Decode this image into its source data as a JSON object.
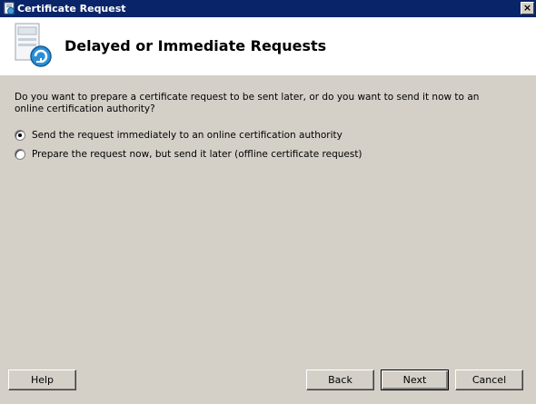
{
  "window": {
    "title": "Certificate Request",
    "close_label": "×"
  },
  "header": {
    "title": "Delayed or Immediate Requests",
    "icon": "certificate-request-icon"
  },
  "content": {
    "question": "Do you want to prepare a certificate request to be sent later, or do you want to send it now to an online certification authority?",
    "options": [
      {
        "label": "Send the request immediately to an online certification authority",
        "selected": true
      },
      {
        "label": "Prepare the request now, but send it later (offline certificate request)",
        "selected": false
      }
    ]
  },
  "buttons": {
    "help": "Help",
    "back": "Back",
    "next": "Next",
    "cancel": "Cancel"
  }
}
